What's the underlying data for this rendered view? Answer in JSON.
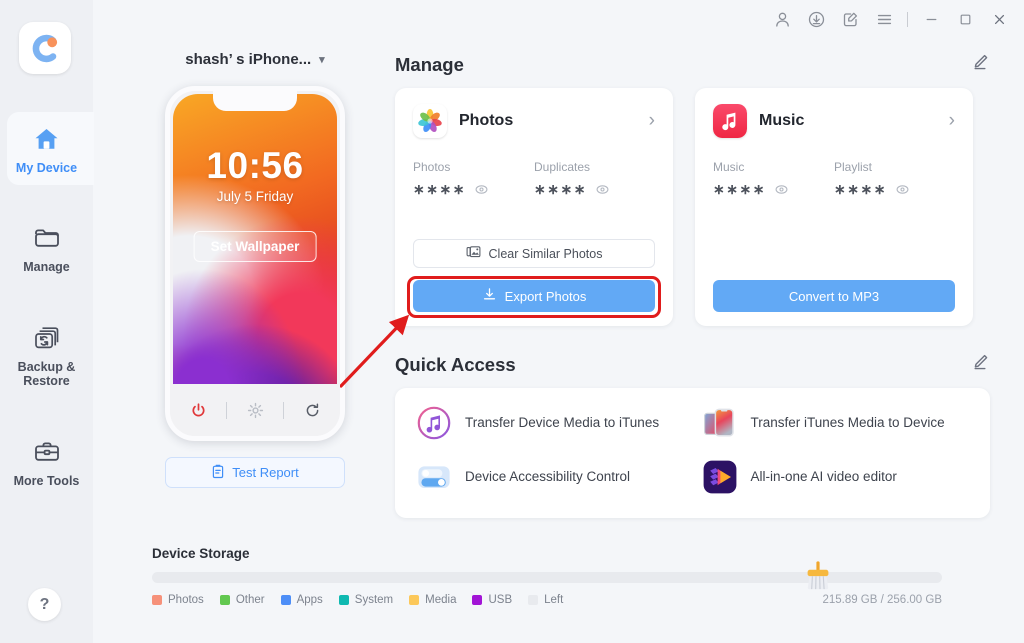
{
  "titlebar": {
    "buttons": [
      {
        "name": "account-icon",
        "label": "Account"
      },
      {
        "name": "download-icon",
        "label": "Downloads"
      },
      {
        "name": "feedback-icon",
        "label": "Feedback"
      },
      {
        "name": "menu-icon",
        "label": "Menu"
      }
    ],
    "window": [
      {
        "name": "minimize-button",
        "label": "Minimize"
      },
      {
        "name": "maximize-button",
        "label": "Maximize"
      },
      {
        "name": "close-button",
        "label": "Close"
      }
    ]
  },
  "sidebar": {
    "logo_alt": "app-logo",
    "items": [
      {
        "label": "My Device",
        "icon": "home-icon",
        "active": true
      },
      {
        "label": "Manage",
        "icon": "folder-icon",
        "active": false
      },
      {
        "label": "Backup & Restore",
        "icon": "backup-restore-icon",
        "active": false
      },
      {
        "label": "More Tools",
        "icon": "toolbox-icon",
        "active": false
      }
    ],
    "help_label": "?"
  },
  "device": {
    "name": "shash’ s iPhone...",
    "lock_time": "10:56",
    "lock_date": "July 5 Friday",
    "set_wallpaper_label": "Set Wallpaper",
    "controls": [
      {
        "name": "power-icon",
        "label": "Power"
      },
      {
        "name": "brightness-icon",
        "label": "Brightness"
      },
      {
        "name": "refresh-icon",
        "label": "Refresh"
      }
    ],
    "test_report_label": "Test Report"
  },
  "manage": {
    "title": "Manage",
    "edit_label": "Edit",
    "cards": [
      {
        "name": "Photos",
        "icon": "photos-app-icon",
        "stats": [
          {
            "label": "Photos",
            "value": "∗∗∗∗"
          },
          {
            "label": "Duplicates",
            "value": "∗∗∗∗"
          }
        ],
        "secondary_button": "Clear Similar Photos",
        "secondary_icon": "similar-photos-icon",
        "primary_button": "Export Photos",
        "primary_icon": "export-icon",
        "highlighted": true
      },
      {
        "name": "Music",
        "icon": "music-app-icon",
        "stats": [
          {
            "label": "Music",
            "value": "∗∗∗∗"
          },
          {
            "label": "Playlist",
            "value": "∗∗∗∗"
          }
        ],
        "secondary_button": "",
        "primary_button": "Convert to MP3",
        "highlighted": false
      }
    ]
  },
  "quick_access": {
    "title": "Quick Access",
    "edit_label": "Edit",
    "items": [
      {
        "label": "Transfer Device Media to iTunes",
        "icon": "itunes-icon"
      },
      {
        "label": "Transfer iTunes Media to Device",
        "icon": "two-phones-icon"
      },
      {
        "label": "Device Accessibility Control",
        "icon": "toggles-icon"
      },
      {
        "label": "All-in-one AI video editor",
        "icon": "video-editor-icon"
      }
    ]
  },
  "storage": {
    "title": "Device Storage",
    "used_total": "215.89 GB / 256.00 GB",
    "clean_icon": "broom-icon",
    "legend": [
      {
        "label": "Photos",
        "color": "#f6917a"
      },
      {
        "label": "Other",
        "color": "#62c850"
      },
      {
        "label": "Apps",
        "color": "#4d8ef7"
      },
      {
        "label": "System",
        "color": "#0fb9b1"
      },
      {
        "label": "Media",
        "color": "#fcc85a"
      },
      {
        "label": "USB",
        "color": "#a214d6"
      },
      {
        "label": "Left",
        "color": "#e8eaee"
      }
    ],
    "segments": [
      {
        "label": "Left",
        "color": "#e8eaee",
        "percent": 100
      }
    ]
  },
  "colors": {
    "accent": "#3f8ef7",
    "primary_button": "#62a9f5",
    "highlight": "#e01c1c",
    "background": "#f4f6f9"
  }
}
